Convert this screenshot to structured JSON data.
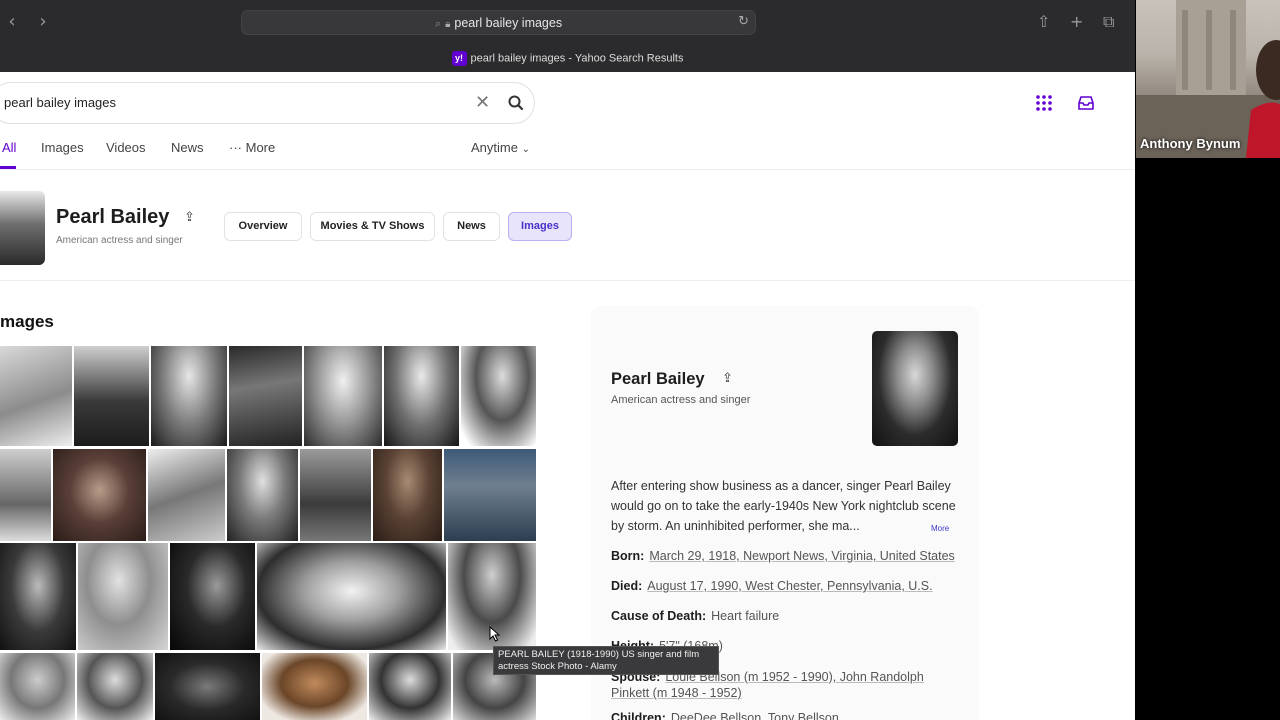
{
  "browser": {
    "url_text": "pearl bailey images",
    "tab_title": "pearl bailey images - Yahoo Search Results",
    "favicon_text": "y!"
  },
  "search": {
    "query": "pearl bailey images",
    "tabs": [
      "All",
      "Images",
      "Videos",
      "News",
      "More"
    ],
    "active_tab": "All",
    "time_filter": "Anytime"
  },
  "entity": {
    "name": "Pearl Bailey",
    "description": "American actress and singer",
    "pills": [
      "Overview",
      "Movies & TV Shows",
      "News",
      "Images"
    ],
    "active_pill": "Images"
  },
  "images_heading": "mages",
  "knowledge_panel": {
    "name": "Pearl Bailey",
    "description": "American actress and singer",
    "abstract": "After entering show business as a dancer, singer Pearl Bailey would go on to take the early-1940s New York nightclub scene by storm. An uninhibited performer, she ma...",
    "more_label": "More",
    "facts": [
      {
        "key": "Born:",
        "value": "March 29, 1918, Newport News, Virginia, United States"
      },
      {
        "key": "Died:",
        "value": "August 17, 1990, West Chester, Pennsylvania, U.S."
      },
      {
        "key": "Cause of Death:",
        "value": "Heart failure"
      },
      {
        "key": "Height:",
        "value": "5'7\" (168m)"
      },
      {
        "key": "Spouse:",
        "value": "Louie Bellson (m 1952 - 1990), John Randolph Pinkett (m 1948 - 1952)"
      },
      {
        "key": "Children:",
        "value": "DeeDee Bellson, Tony Bellson"
      }
    ]
  },
  "tooltip": "PEARL BAILEY (1918-1990) US singer and film actress Stock Photo - Alamy",
  "webcam": {
    "participant_name": "Anthony Bynum"
  },
  "colors": {
    "accent": "#6001d2",
    "titlebar": "#2b2b2d",
    "pill_active_bg": "#e7e4fb"
  }
}
